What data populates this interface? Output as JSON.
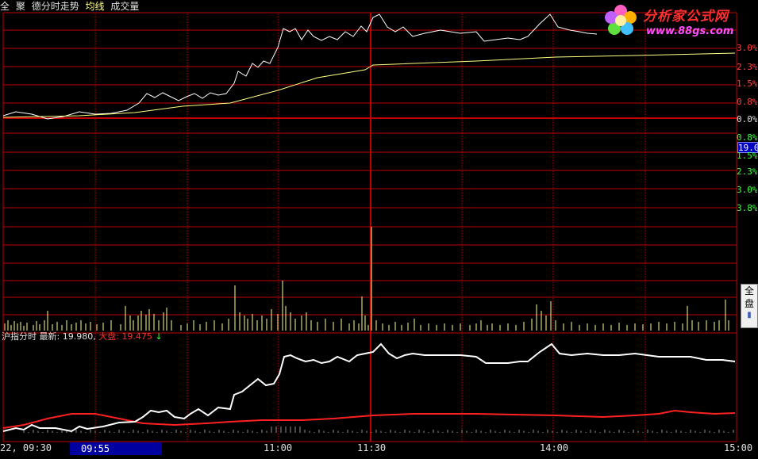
{
  "header": {
    "items": [
      "全",
      "聚",
      "德分时走势",
      "均线",
      "成交量"
    ]
  },
  "logo": {
    "name": "分析家公式网",
    "url": "www.88gs.com"
  },
  "right_axis_top": [
    "3.0%",
    "2.3%",
    "1.5%",
    "0.8%",
    "0.0%",
    "0.8%"
  ],
  "right_axis_bottom": [
    "1.5%",
    "2.3%",
    "3.0%",
    "3.8%"
  ],
  "price_badge": "19.0",
  "index_panel": {
    "name": "沪指分时",
    "latest_label": "最新:",
    "latest_value": "19.980,",
    "market_label": "大盘:",
    "market_value": "19.475",
    "arrow": "↓"
  },
  "side_widget": [
    "全",
    "盘"
  ],
  "time_axis": {
    "date_time": "22, 09:30",
    "cursor": "09:55",
    "ticks": [
      "11:00",
      "11:30",
      "14:00",
      "15:00"
    ]
  },
  "colors": {
    "grid": "#c00000",
    "price_line": "#ffffff",
    "avg_line": "#ffff80",
    "volume": "#ffff80",
    "index_line": "#ffffff",
    "index_ref": "#ff2020"
  }
}
